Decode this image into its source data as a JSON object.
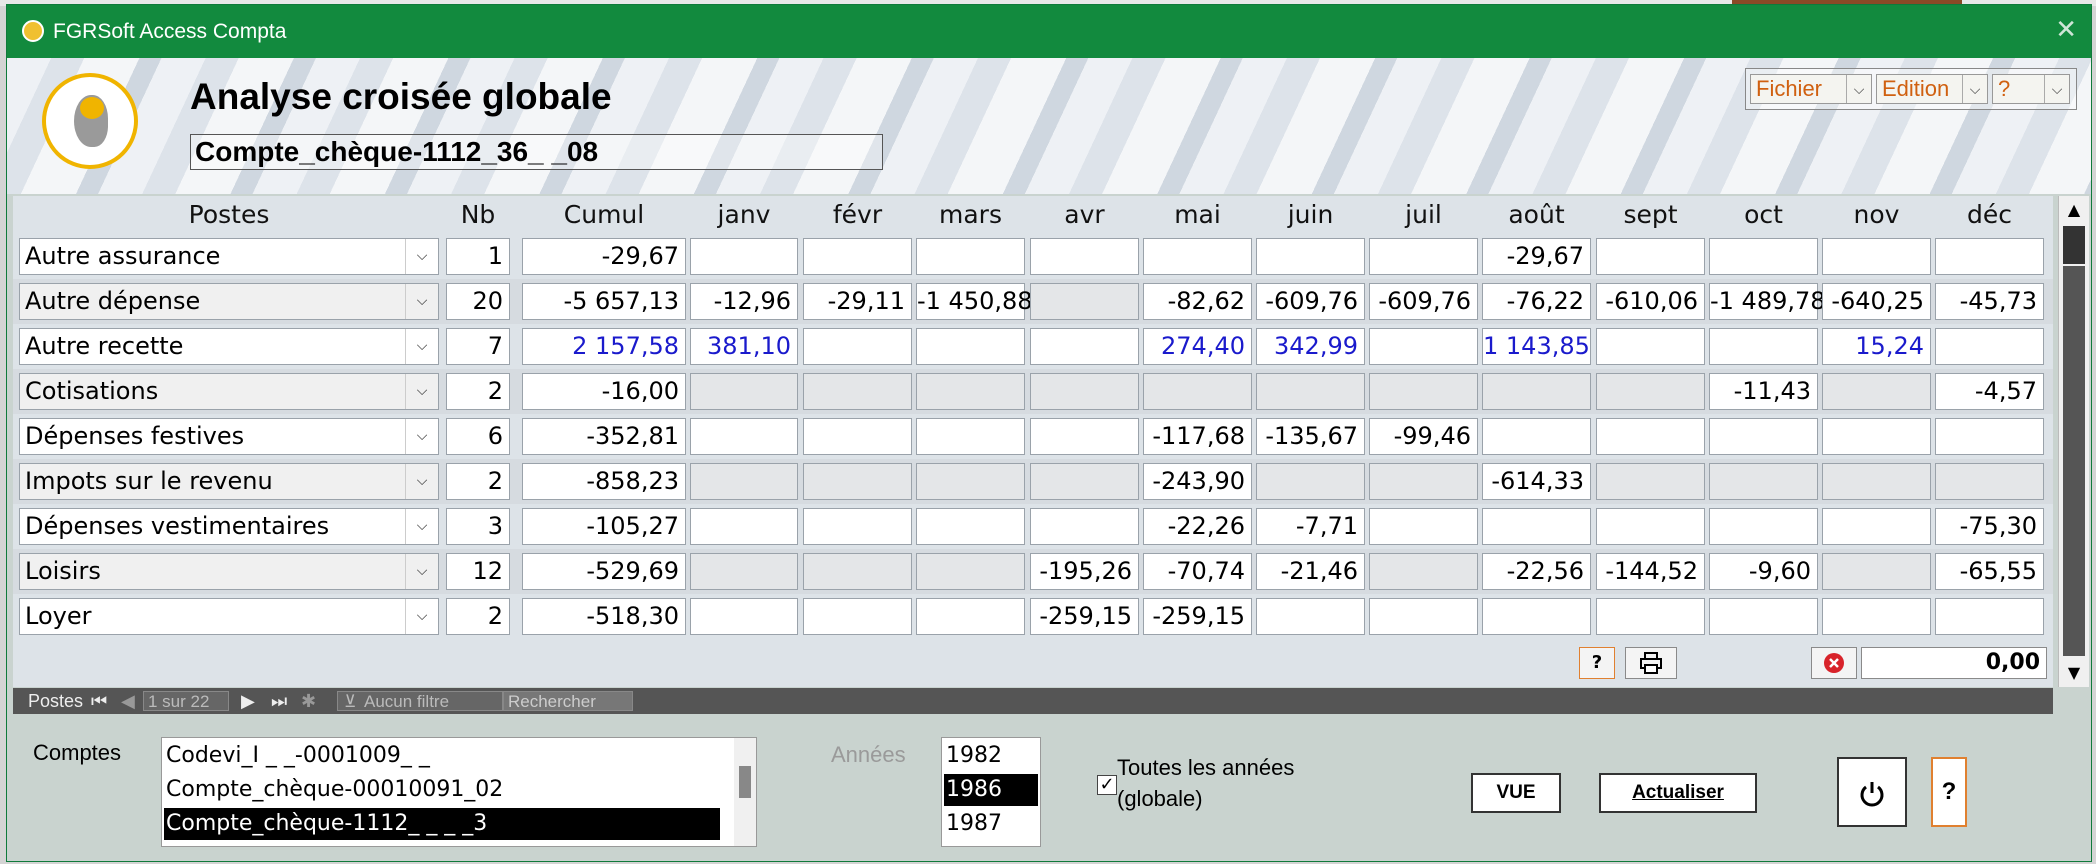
{
  "window": {
    "title": "FGRSoft Access Compta",
    "close_glyph": "✕"
  },
  "header": {
    "title": "Analyse croisée globale",
    "account": "Compte_chèque-1112_36_ _08"
  },
  "menus": [
    {
      "label": "Fichier"
    },
    {
      "label": "Edition"
    },
    {
      "label": "?"
    }
  ],
  "grid": {
    "columns": [
      "Postes",
      "Nb",
      "Cumul",
      "janv",
      "févr",
      "mars",
      "avr",
      "mai",
      "juin",
      "juil",
      "août",
      "sept",
      "oct",
      "nov",
      "déc"
    ],
    "rows": [
      {
        "poste": "Autre assurance",
        "nb": "1",
        "cumul": "-29,67",
        "months": [
          "",
          "",
          "",
          "",
          "",
          "",
          "",
          "-29,67",
          "",
          "",
          "",
          ""
        ]
      },
      {
        "poste": "Autre dépense",
        "nb": "20",
        "cumul": "-5 657,13",
        "months": [
          "-12,96",
          "-29,11",
          "-1 450,88",
          "",
          "-82,62",
          "-609,76",
          "-609,76",
          "-76,22",
          "-610,06",
          "-1 489,78",
          "-640,25",
          "-45,73"
        ]
      },
      {
        "poste": "Autre recette",
        "nb": "7",
        "cumul": "2 157,58",
        "months": [
          "381,10",
          "",
          "",
          "",
          "274,40",
          "342,99",
          "",
          "1 143,85",
          "",
          "",
          "15,24",
          ""
        ]
      },
      {
        "poste": "Cotisations",
        "nb": "2",
        "cumul": "-16,00",
        "months": [
          "",
          "",
          "",
          "",
          "",
          "",
          "",
          "",
          "",
          "-11,43",
          "",
          "-4,57"
        ]
      },
      {
        "poste": "Dépenses festives",
        "nb": "6",
        "cumul": "-352,81",
        "months": [
          "",
          "",
          "",
          "",
          "-117,68",
          "-135,67",
          "-99,46",
          "",
          "",
          "",
          "",
          ""
        ]
      },
      {
        "poste": "Impots sur le revenu",
        "nb": "2",
        "cumul": "-858,23",
        "months": [
          "",
          "",
          "",
          "",
          "-243,90",
          "",
          "",
          "-614,33",
          "",
          "",
          "",
          ""
        ]
      },
      {
        "poste": "Dépenses vestimentaires",
        "nb": "3",
        "cumul": "-105,27",
        "months": [
          "",
          "",
          "",
          "",
          "-22,26",
          "-7,71",
          "",
          "",
          "",
          "",
          "",
          "-75,30"
        ]
      },
      {
        "poste": "Loisirs",
        "nb": "12",
        "cumul": "-529,69",
        "months": [
          "",
          "",
          "",
          "-195,26",
          "-70,74",
          "-21,46",
          "",
          "-22,56",
          "-144,52",
          "-9,60",
          "",
          "-65,55"
        ]
      },
      {
        "poste": "Loyer",
        "nb": "2",
        "cumul": "-518,30",
        "months": [
          "",
          "",
          "",
          "-259,15",
          "-259,15",
          "",
          "",
          "",
          "",
          "",
          "",
          ""
        ]
      }
    ],
    "help_label": "?",
    "total": "0,00"
  },
  "navbar": {
    "label": "Postes",
    "record": "1 sur 22",
    "filter": "Aucun filtre",
    "search_placeholder": "Rechercher"
  },
  "bottom": {
    "comptes_label": "Comptes",
    "comptes": [
      "Codevi_I _ _-0001009_ _",
      "Compte_chèque-00010091_02",
      "Compte_chèque-1112_ _ _ _3"
    ],
    "annees_label": "Années",
    "annees": [
      "1982",
      "1986",
      "1987"
    ],
    "toutes_label_1": "Toutes les années",
    "toutes_label_2": "(globale)",
    "vue_label": "VUE",
    "actualiser_label": "Actualiser",
    "help_label": "?"
  },
  "colors": {
    "titlebar": "#128a3e",
    "positive": "#1a1acc",
    "menu_text": "#d06010"
  }
}
